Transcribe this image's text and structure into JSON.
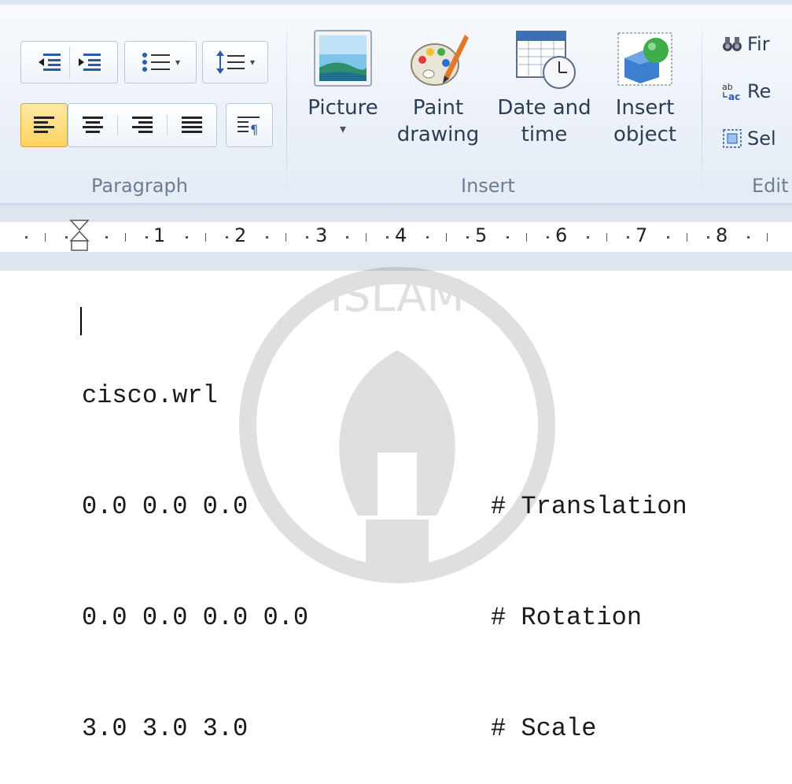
{
  "ribbon": {
    "paragraph": {
      "label": "Paragraph"
    },
    "insert": {
      "label": "Insert",
      "picture_label": "Picture",
      "paint_label_1": "Paint",
      "paint_label_2": "drawing",
      "datetime_label_1": "Date and",
      "datetime_label_2": "time",
      "object_label_1": "Insert",
      "object_label_2": "object"
    },
    "editing": {
      "label": "Edit",
      "find_label": "Fir",
      "replace_label": "Re",
      "select_label": "Sel"
    }
  },
  "ruler": {
    "numbers": [
      "1",
      "2",
      "3",
      "4",
      "5",
      "6",
      "7",
      "8"
    ]
  },
  "watermark": {
    "text": "ISLAM"
  },
  "document": {
    "lines": [
      {
        "left": "cisco.wrl",
        "right": ""
      },
      {
        "left": "0.0 0.0 0.0",
        "right": "# Translation"
      },
      {
        "left": "0.0 0.0 0.0 0.0",
        "right": "# Rotation"
      },
      {
        "left": "3.0 3.0 3.0",
        "right": "# Scale"
      }
    ]
  },
  "colors": {
    "active_button": "#ffd25e",
    "ribbon_bg": "#eef3fa",
    "group_label": "#6b7d94"
  }
}
